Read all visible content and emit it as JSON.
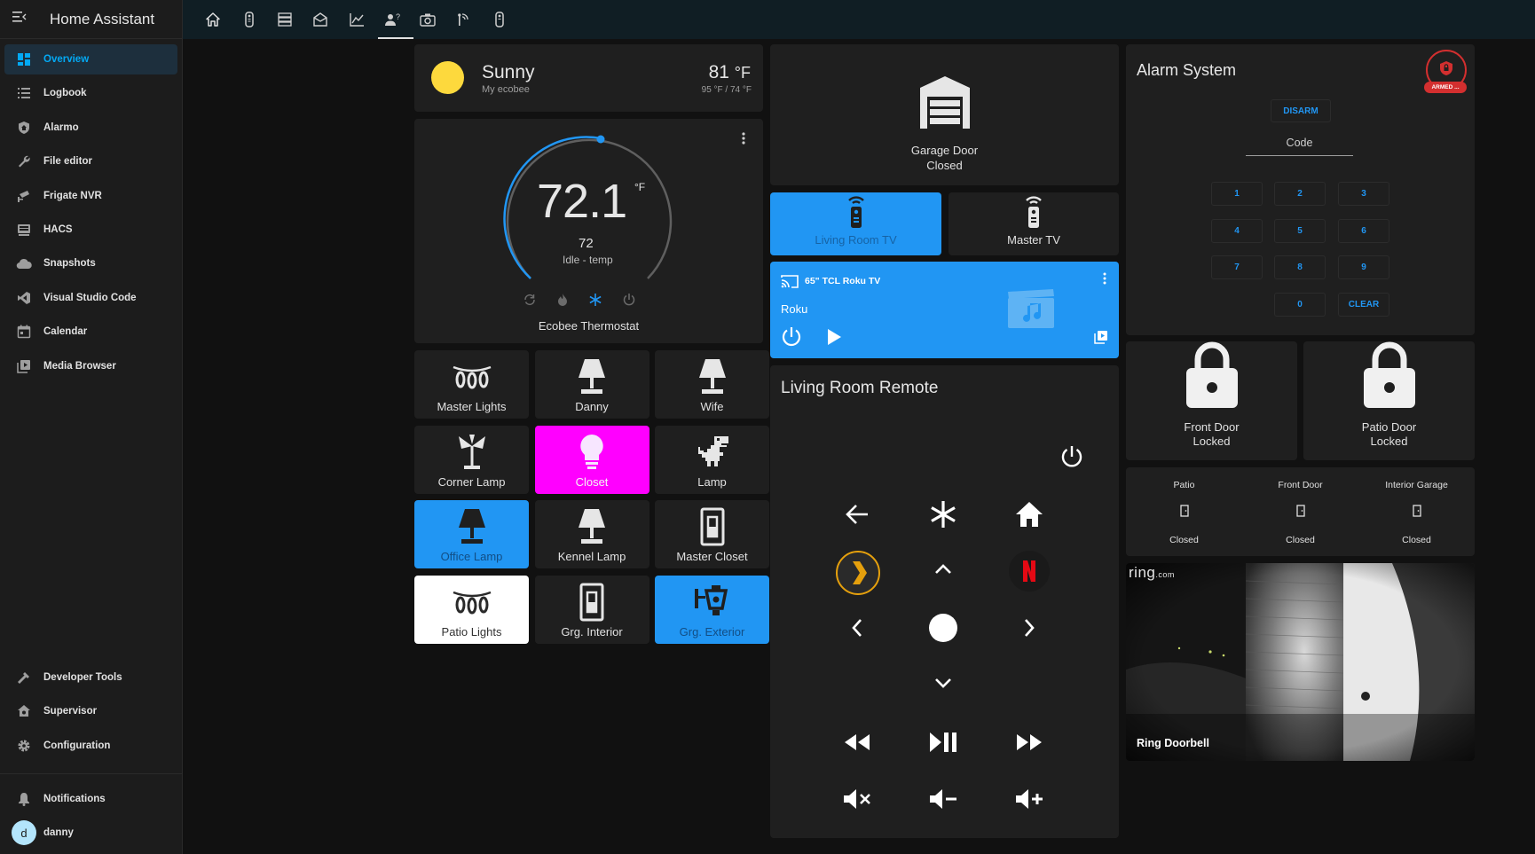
{
  "app": {
    "title": "Home Assistant"
  },
  "sidebar": {
    "items": [
      {
        "label": "Overview",
        "icon": "dashboard-icon"
      },
      {
        "label": "Logbook",
        "icon": "list-icon"
      },
      {
        "label": "Alarmo",
        "icon": "shield-home-icon"
      },
      {
        "label": "File editor",
        "icon": "wrench-icon"
      },
      {
        "label": "Frigate NVR",
        "icon": "cctv-icon"
      },
      {
        "label": "HACS",
        "icon": "hacs-icon"
      },
      {
        "label": "Snapshots",
        "icon": "cloud-icon"
      },
      {
        "label": "Visual Studio Code",
        "icon": "vscode-icon"
      },
      {
        "label": "Calendar",
        "icon": "calendar-icon"
      },
      {
        "label": "Media Browser",
        "icon": "media-browser-icon"
      }
    ],
    "bottom": [
      {
        "label": "Developer Tools",
        "icon": "hammer-icon"
      },
      {
        "label": "Supervisor",
        "icon": "supervisor-icon"
      },
      {
        "label": "Configuration",
        "icon": "gear-icon"
      }
    ],
    "notifications": "Notifications",
    "user": {
      "initial": "d",
      "name": "danny"
    }
  },
  "weather": {
    "condition": "Sunny",
    "source": "My ecobee",
    "temp": "81",
    "unit": "°F",
    "hilo": "95 °F / 74 °F"
  },
  "thermostat": {
    "current": "72.1",
    "unit": "°F",
    "target": "72",
    "status": "Idle - temp",
    "name": "Ecobee Thermostat"
  },
  "tiles": [
    {
      "label": "Master Lights",
      "icon": "string-lights-icon",
      "state": "off"
    },
    {
      "label": "Danny",
      "icon": "lamp-icon",
      "state": "off"
    },
    {
      "label": "Wife",
      "icon": "lamp-icon",
      "state": "off"
    },
    {
      "label": "Corner Lamp",
      "icon": "floor-lamp-icon",
      "state": "off"
    },
    {
      "label": "Closet",
      "icon": "lightbulb-icon",
      "state": "on",
      "color": "#ff00ff"
    },
    {
      "label": "Lamp",
      "icon": "dino-icon",
      "state": "off"
    },
    {
      "label": "Office Lamp",
      "icon": "lamp-icon",
      "state": "on",
      "color": "#2196f3"
    },
    {
      "label": "Kennel Lamp",
      "icon": "lamp-icon",
      "state": "off"
    },
    {
      "label": "Master Closet",
      "icon": "light-switch-icon",
      "state": "off"
    },
    {
      "label": "Patio Lights",
      "icon": "string-lights-icon",
      "state": "on",
      "color": "#ffffff"
    },
    {
      "label": "Grg. Interior",
      "icon": "light-switch-icon",
      "state": "off"
    },
    {
      "label": "Grg. Exterior",
      "icon": "outdoor-lamp-icon",
      "state": "on",
      "color": "#2196f3"
    }
  ],
  "garage": {
    "name": "Garage Door",
    "state": "Closed"
  },
  "remotes": [
    {
      "label": "Living Room TV",
      "state": "on"
    },
    {
      "label": "Master TV",
      "state": "off"
    }
  ],
  "media": {
    "device": "65\" TCL Roku TV",
    "source": "Roku"
  },
  "living_remote": {
    "title": "Living Room Remote"
  },
  "alarm": {
    "title": "Alarm System",
    "badge": "ARMED ...",
    "disarm": "DISARM",
    "code_label": "Code",
    "keys": [
      "1",
      "2",
      "3",
      "4",
      "5",
      "6",
      "7",
      "8",
      "9",
      "0",
      "CLEAR"
    ]
  },
  "locks": [
    {
      "name": "Front Door",
      "state": "Locked"
    },
    {
      "name": "Patio Door",
      "state": "Locked"
    }
  ],
  "doors": [
    {
      "name": "Patio",
      "state": "Closed"
    },
    {
      "name": "Front Door",
      "state": "Closed"
    },
    {
      "name": "Interior Garage",
      "state": "Closed"
    }
  ],
  "camera": {
    "brand": "ring",
    "brand_suffix": ".com",
    "name": "Ring Doorbell"
  },
  "colors": {
    "accent": "#03a9f4",
    "blue": "#2196f3",
    "pink": "#ff00ff",
    "card": "#1f1f1f",
    "alarm_red": "#d32f2f"
  }
}
